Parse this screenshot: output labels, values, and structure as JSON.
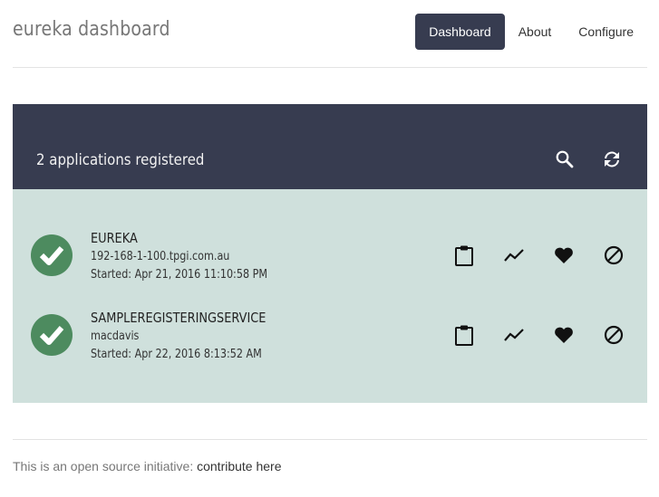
{
  "header": {
    "brand": "eureka dashboard",
    "nav": [
      {
        "label": "Dashboard",
        "active": true
      },
      {
        "label": "About",
        "active": false
      },
      {
        "label": "Configure",
        "active": false
      }
    ]
  },
  "panel": {
    "title": "2 applications registered",
    "icons": [
      "search-icon",
      "refresh-icon"
    ]
  },
  "applications": [
    {
      "name": "EUREKA",
      "host": "192-168-1-100.tpgi.com.au",
      "started": "Started: Apr 21, 2016 11:10:58 PM",
      "status": "up"
    },
    {
      "name": "SAMPLEREGISTERINGSERVICE",
      "host": "macdavis",
      "started": "Started: Apr 22, 2016 8:13:52 AM",
      "status": "up"
    }
  ],
  "row_actions": [
    "clipboard-icon",
    "metrics-icon",
    "health-icon",
    "disable-icon"
  ],
  "footer": {
    "text": "This is an open source initiative: ",
    "link": "contribute here"
  },
  "colors": {
    "navy": "#373c50",
    "panel_bg": "#cfe0dc",
    "status_green": "#4d8b5f"
  }
}
